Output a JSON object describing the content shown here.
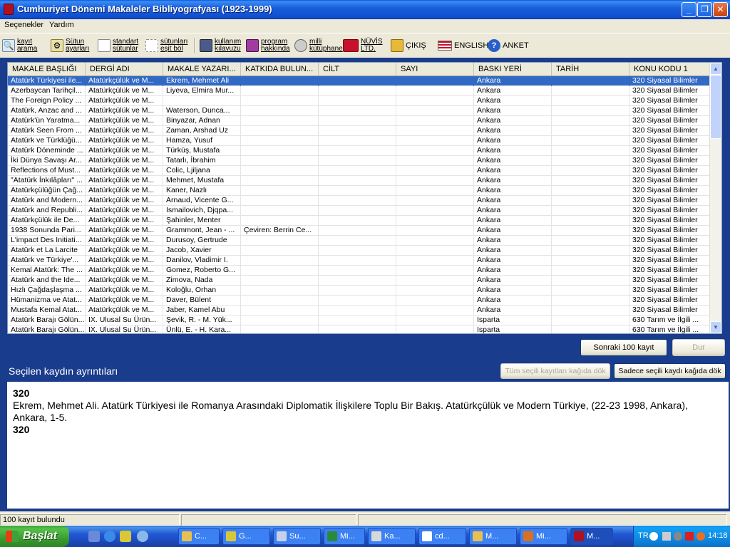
{
  "window": {
    "title": "Cumhuriyet Dönemi Makaleler Bibliyografyası (1923-1999)"
  },
  "menu": [
    "Seçenekler",
    "Yardım"
  ],
  "toolbar": [
    {
      "label": "kayıt\narama",
      "icon": "search-icon"
    },
    {
      "label": "Sütun\nayarları",
      "icon": "columns-settings-icon"
    },
    {
      "label": "standart\nsütunlar",
      "icon": "document-icon"
    },
    {
      "label": "sütunları\neşit böl",
      "icon": "document-split-icon"
    },
    {
      "label": "kullanım\nkılavuzu",
      "icon": "manual-icon"
    },
    {
      "label": "program\nhakkında",
      "icon": "info-book-icon"
    },
    {
      "label": "milli\nkütüphane",
      "icon": "library-icon"
    },
    {
      "label": "NÜVİS\nLTD.",
      "icon": "nuvis-logo-icon"
    },
    {
      "label": "ÇIKIŞ",
      "icon": "exit-icon"
    },
    {
      "label": "ENGLISH",
      "icon": "us-flag-icon"
    },
    {
      "label": "ANKET",
      "icon": "help-icon"
    }
  ],
  "grid": {
    "columns": [
      "MAKALE BAŞLIĞI",
      "DERGİ ADI",
      "MAKALE YAZARI...",
      "KATKIDA BULUN...",
      "CİLT",
      "SAYI",
      "BASKI YERİ",
      "TARİH",
      "KONU KODU 1"
    ],
    "rows": [
      [
        "Atatürk Türkiyesi ile...",
        "Atatürkçülük ve M...",
        "Ekrem, Mehmet Ali",
        "",
        "",
        "",
        "Ankara",
        "",
        "320 Siyasal Bilimler"
      ],
      [
        "Azerbaycan Tarihçil...",
        "Atatürkçülük ve M...",
        "Liyeva, Elmira Mur...",
        "",
        "",
        "",
        "Ankara",
        "",
        "320 Siyasal Bilimler"
      ],
      [
        "The Foreign Policy ...",
        "Atatürkçülük ve M...",
        "",
        "",
        "",
        "",
        "Ankara",
        "",
        "320 Siyasal Bilimler"
      ],
      [
        "Atatürk, Anzac and ...",
        "Atatürkçülük ve M...",
        "Waterson, Dunca...",
        "",
        "",
        "",
        "Ankara",
        "",
        "320 Siyasal Bilimler"
      ],
      [
        "Atatürk'ün Yaratma...",
        "Atatürkçülük ve M...",
        "Binyazar, Adnan",
        "",
        "",
        "",
        "Ankara",
        "",
        "320 Siyasal Bilimler"
      ],
      [
        "Atatürk Seen From ...",
        "Atatürkçülük ve M...",
        "Zaman, Arshad Uz",
        "",
        "",
        "",
        "Ankara",
        "",
        "320 Siyasal Bilimler"
      ],
      [
        "Atatürk ve Türklüğü...",
        "Atatürkçülük ve M...",
        "Hamza, Yusuf",
        "",
        "",
        "",
        "Ankara",
        "",
        "320 Siyasal Bilimler"
      ],
      [
        "Atatürk Döneminde ...",
        "Atatürkçülük ve M...",
        "Türküş, Mustafa",
        "",
        "",
        "",
        "Ankara",
        "",
        "320 Siyasal Bilimler"
      ],
      [
        "İki Dünya Savaşı Ar...",
        "Atatürkçülük ve M...",
        "Tatarlı, İbrahim",
        "",
        "",
        "",
        "Ankara",
        "",
        "320 Siyasal Bilimler"
      ],
      [
        "Reflections of Must...",
        "Atatürkçülük ve M...",
        "Colic, Ljiljana",
        "",
        "",
        "",
        "Ankara",
        "",
        "320 Siyasal Bilimler"
      ],
      [
        "\"Atatürk İnkılâpları\" ...",
        "Atatürkçülük ve M...",
        "Mehmet, Mustafa",
        "",
        "",
        "",
        "Ankara",
        "",
        "320 Siyasal Bilimler"
      ],
      [
        "Atatürkçülüğün Çağ...",
        "Atatürkçülük ve M...",
        "Kaner, Nazlı",
        "",
        "",
        "",
        "Ankara",
        "",
        "320 Siyasal Bilimler"
      ],
      [
        "Atatürk and Modern...",
        "Atatürkçülük ve M...",
        "Arnaud, Vicente G...",
        "",
        "",
        "",
        "Ankara",
        "",
        "320 Siyasal Bilimler"
      ],
      [
        "Atatürk and Republi...",
        "Atatürkçülük ve M...",
        "Ismailovich, Djqpa...",
        "",
        "",
        "",
        "Ankara",
        "",
        "320 Siyasal Bilimler"
      ],
      [
        "Atatürkçülük ile De...",
        "Atatürkçülük ve M...",
        "Şahinler, Menter",
        "",
        "",
        "",
        "Ankara",
        "",
        "320 Siyasal Bilimler"
      ],
      [
        "1938 Sonunda Pari...",
        "Atatürkçülük ve M...",
        "Grammont, Jean - ...",
        "Çeviren: Berrin Ce...",
        "",
        "",
        "Ankara",
        "",
        "320 Siyasal Bilimler"
      ],
      [
        "L'impact Des Initiati...",
        "Atatürkçülük ve M...",
        "Durusoy, Gertrude",
        "",
        "",
        "",
        "Ankara",
        "",
        "320 Siyasal Bilimler"
      ],
      [
        "Atatürk et La Larcite",
        "Atatürkçülük ve M...",
        "Jacob, Xavier",
        "",
        "",
        "",
        "Ankara",
        "",
        "320 Siyasal Bilimler"
      ],
      [
        "Atatürk ve Türkiye'...",
        "Atatürkçülük ve M...",
        "Danilov, Vladimir I.",
        "",
        "",
        "",
        "Ankara",
        "",
        "320 Siyasal Bilimler"
      ],
      [
        "Kemal Atatürk: The ...",
        "Atatürkçülük ve M...",
        "Gomez, Roberto G...",
        "",
        "",
        "",
        "Ankara",
        "",
        "320 Siyasal Bilimler"
      ],
      [
        "Atatürk and the Ide...",
        "Atatürkçülük ve M...",
        "Zimova, Nada",
        "",
        "",
        "",
        "Ankara",
        "",
        "320 Siyasal Bilimler"
      ],
      [
        "Hızlı Çağdaşlaşma ...",
        "Atatürkçülük ve M...",
        "Koloğlu, Orhan",
        "",
        "",
        "",
        "Ankara",
        "",
        "320 Siyasal Bilimler"
      ],
      [
        "Hümanizma ve Atat...",
        "Atatürkçülük ve M...",
        "Daver, Bülent",
        "",
        "",
        "",
        "Ankara",
        "",
        "320 Siyasal Bilimler"
      ],
      [
        "Mustafa Kemal Atat...",
        "Atatürkçülük ve M...",
        "Jaber, Kamel Abu",
        "",
        "",
        "",
        "Ankara",
        "",
        "320 Siyasal Bilimler"
      ],
      [
        "Atatürk Barajı Gölün...",
        "IX. Ulusal Su Ürün...",
        "Şevik, R. - M. Yük...",
        "",
        "",
        "",
        "Isparta",
        "",
        "630 Tarım ve İlgili ..."
      ],
      [
        "Atatürk Barajı Gölün...",
        "IX. Ulusal Su Ürün...",
        "Ünlü, E. - H. Kara...",
        "",
        "",
        "",
        "Isparta",
        "",
        "630 Tarım ve İlgili ..."
      ]
    ]
  },
  "buttons": {
    "next": "Sonraki 100 kayıt",
    "stop": "Dur",
    "print_all": "Tüm seçili kayıtları kağıda dök",
    "print_selected": "Sadece seçili kaydı kağıda dök"
  },
  "details": {
    "title": "Seçilen kaydın ayrıntıları",
    "code_top": "320",
    "citation": "Ekrem, Mehmet Ali. Atatürk Türkiyesi ile Romanya Arasındaki Diplomatik İlişkilere Toplu Bir Bakış. Atatürkçülük ve Modern Türkiye, (22-23 1998, Ankara), Ankara, 1-5.",
    "code_bottom": "320"
  },
  "status": {
    "text": "100 kayıt bulundu"
  },
  "taskbar": {
    "start": "Başlat",
    "tasks": [
      "C...",
      "G...",
      "Su...",
      "Mi...",
      "Ka...",
      "cd...",
      "M...",
      "Mi...",
      "M..."
    ],
    "lang": "TR",
    "clock": "14:18"
  },
  "colors": {
    "panel": "#1a3c8c",
    "selection": "#316ac5",
    "titlebar": "#0a5ad8"
  }
}
